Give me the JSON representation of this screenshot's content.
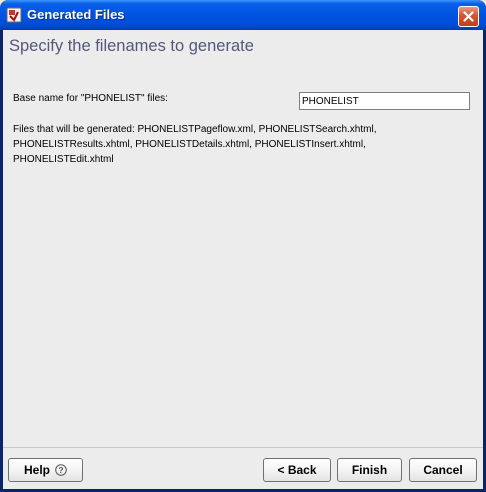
{
  "window": {
    "title": "Generated Files"
  },
  "header": {
    "heading": "Specify the filenames to generate"
  },
  "form": {
    "base_label": "Base name for \"PHONELIST\" files:",
    "base_value": "PHONELIST",
    "files_text": "Files that will be generated: PHONELISTPageflow.xml, PHONELISTSearch.xhtml, PHONELISTResults.xhtml, PHONELISTDetails.xhtml, PHONELISTInsert.xhtml, PHONELISTEdit.xhtml"
  },
  "footer": {
    "help_label": "Help",
    "back_label": "< Back",
    "finish_label": "Finish",
    "cancel_label": "Cancel"
  },
  "icons": {
    "title_icon": "app-icon",
    "close_icon": "close-icon",
    "help_icon": "question-mark-icon"
  },
  "colors": {
    "titlebar": "#0053e2",
    "heading": "#54577a",
    "close_button": "#d9542e"
  }
}
